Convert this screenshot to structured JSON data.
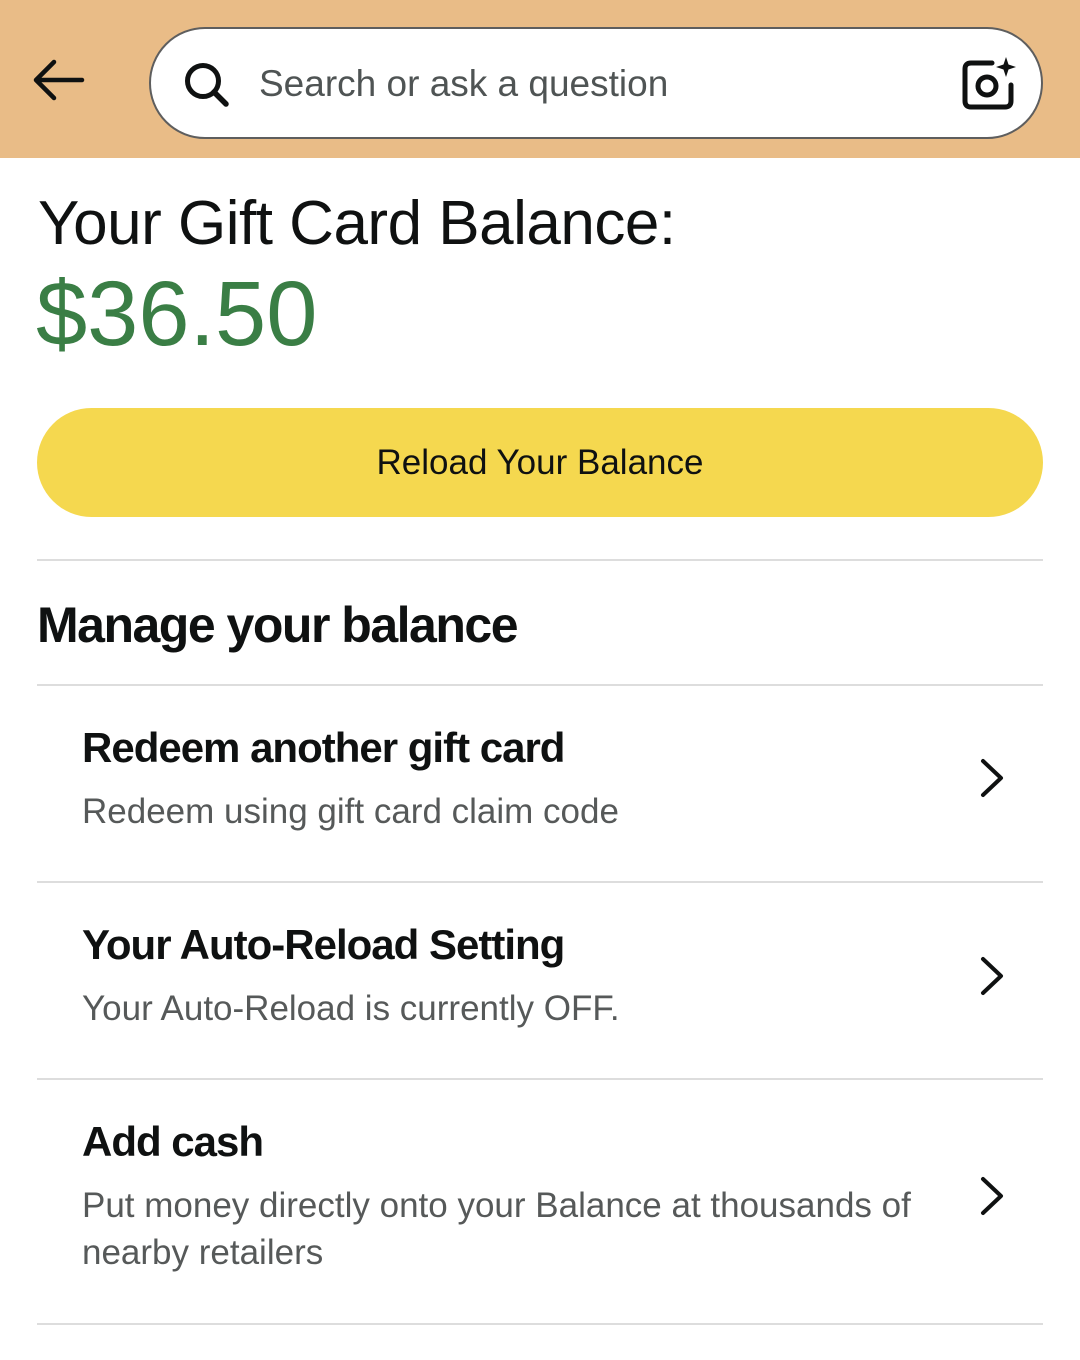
{
  "header": {
    "background_color": "#e9bc87",
    "back_icon": "arrow-left-icon",
    "search": {
      "placeholder": "Search or ask a question",
      "value": "",
      "search_icon": "magnifier-icon",
      "camera_icon": "camera-sparkle-icon"
    }
  },
  "balance": {
    "title": "Your Gift Card Balance:",
    "amount": "$36.50",
    "amount_color": "#3a7e45",
    "reload_label": "Reload Your Balance",
    "reload_color": "#f5d84f"
  },
  "manage": {
    "heading": "Manage your balance",
    "items": [
      {
        "title": "Redeem another gift card",
        "subtitle": "Redeem using gift card claim code",
        "icon": "chevron-right-icon"
      },
      {
        "title": "Your Auto-Reload Setting",
        "subtitle": "Your Auto-Reload is currently OFF.",
        "icon": "chevron-right-icon"
      },
      {
        "title": "Add cash",
        "subtitle": "Put money directly onto your Balance at thousands of nearby retailers",
        "icon": "chevron-right-icon"
      }
    ]
  }
}
